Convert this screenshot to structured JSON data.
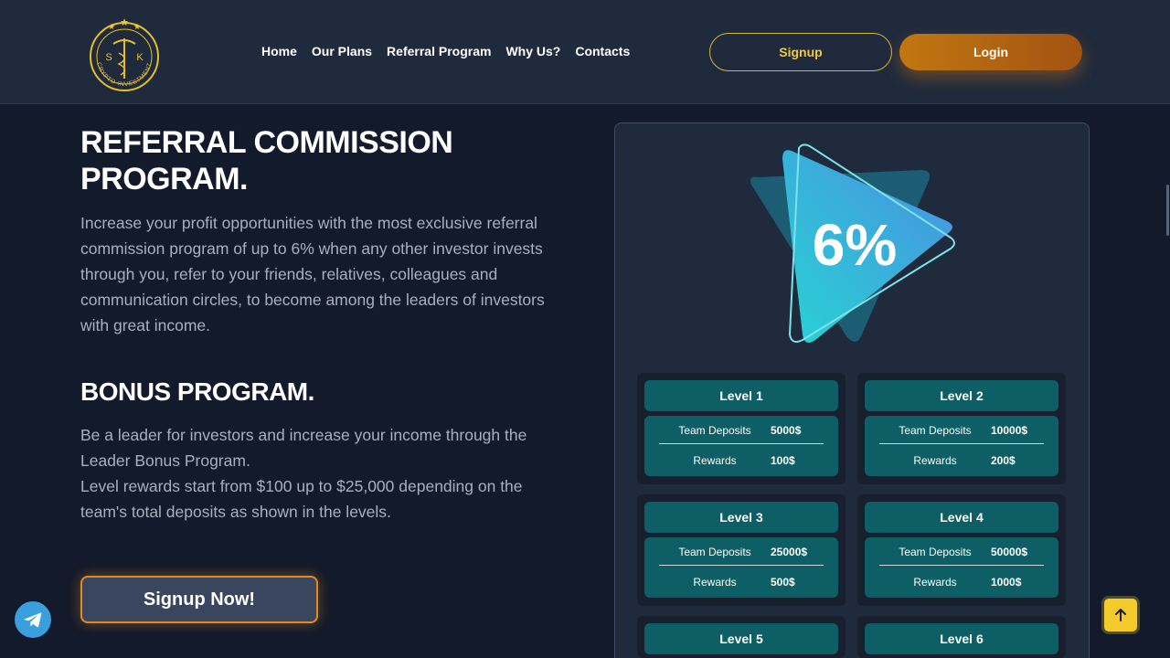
{
  "header": {
    "logo": {
      "letters": [
        "S",
        "K"
      ],
      "text": "CRYPTO INVESTMENT"
    },
    "nav": [
      "Home",
      "Our Plans",
      "Referral Program",
      "Why Us?",
      "Contacts"
    ],
    "signup_label": "Signup",
    "login_label": "Login"
  },
  "referral": {
    "title": "REFERRAL COMMISSION PROGRAM.",
    "body": "Increase your profit opportunities with the most exclusive referral commission program of up to 6% when any other investor invests through you, refer to your friends, relatives, colleagues and communication circles, to become among the leaders of investors with great income."
  },
  "bonus": {
    "title": "BONUS PROGRAM.",
    "body_line1": "Be a leader for investors and increase your income through the Leader Bonus Program.",
    "body_line2": "Level rewards start from $100 up to $25,000 depending on the team's total deposits as shown in the levels."
  },
  "cta_label": "Signup Now!",
  "card": {
    "percent": "6%",
    "levels": [
      {
        "title": "Level 1",
        "deposits_label": "Team Deposits",
        "deposits": "5000$",
        "rewards_label": "Rewards",
        "rewards": "100$"
      },
      {
        "title": "Level 2",
        "deposits_label": "Team Deposits",
        "deposits": "10000$",
        "rewards_label": "Rewards",
        "rewards": "200$"
      },
      {
        "title": "Level 3",
        "deposits_label": "Team Deposits",
        "deposits": "25000$",
        "rewards_label": "Rewards",
        "rewards": "500$"
      },
      {
        "title": "Level 4",
        "deposits_label": "Team Deposits",
        "deposits": "50000$",
        "rewards_label": "Rewards",
        "rewards": "1000$"
      },
      {
        "title": "Level 5"
      },
      {
        "title": "Level 6"
      }
    ]
  },
  "colors": {
    "accent_gold": "#f3cb3a",
    "accent_orange": "#c17710",
    "level_teal": "#0e5f65",
    "background": "#131a2b"
  },
  "icons": {
    "telegram": "telegram-icon",
    "scroll_top": "arrow-up-icon"
  }
}
